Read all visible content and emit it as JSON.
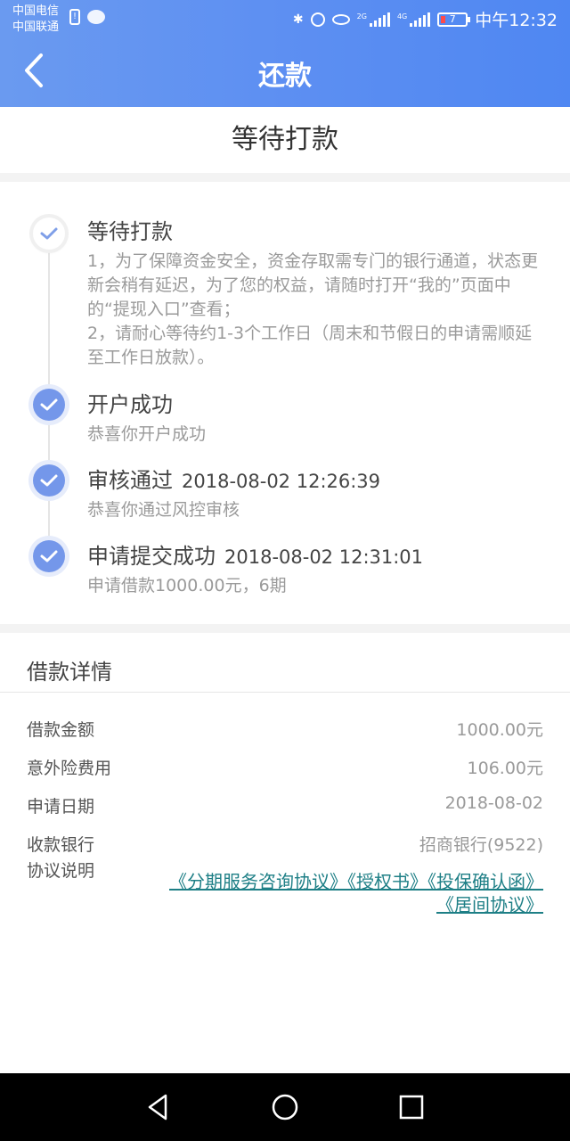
{
  "status_bar": {
    "carrier1": "中国电信",
    "carrier2": "中国联通",
    "net1": "2G",
    "net2": "4G",
    "battery": "7",
    "time": "中午12:32"
  },
  "header": {
    "title": "还款"
  },
  "banner": {
    "text": "等待打款"
  },
  "timeline": [
    {
      "title": "等待打款",
      "time": "",
      "desc": "1，为了保障资金安全，资金存取需专门的银行通道，状态更新会稍有延迟，为了您的权益，请随时打开“我的”页面中的“提现入口”查看；\n2，请耐心等待约1-3个工作日（周末和节假日的申请需顺延至工作日放款）。"
    },
    {
      "title": "开户成功",
      "time": "",
      "desc": "恭喜你开户成功"
    },
    {
      "title": "审核通过",
      "time": "2018-08-02 12:26:39",
      "desc": "恭喜你通过风控审核"
    },
    {
      "title": "申请提交成功",
      "time": "2018-08-02 12:31:01",
      "desc": "申请借款1000.00元，6期"
    }
  ],
  "details": {
    "title": "借款详情",
    "rows": [
      {
        "label": "借款金额",
        "value": "1000.00元"
      },
      {
        "label": "意外险费用",
        "value": "106.00元"
      },
      {
        "label": "申请日期",
        "value": "2018-08-02"
      },
      {
        "label": "收款银行",
        "value": "招商银行(9522)"
      },
      {
        "label": "协议说明",
        "value": ""
      }
    ],
    "agreements": [
      "《分期服务咨询协议》",
      "《授权书》",
      "《投保确认函》",
      "《居间协议》"
    ]
  },
  "colors": {
    "accent": "#5d8ff2",
    "link": "#1e7f86",
    "muted": "#9a9a9a"
  }
}
